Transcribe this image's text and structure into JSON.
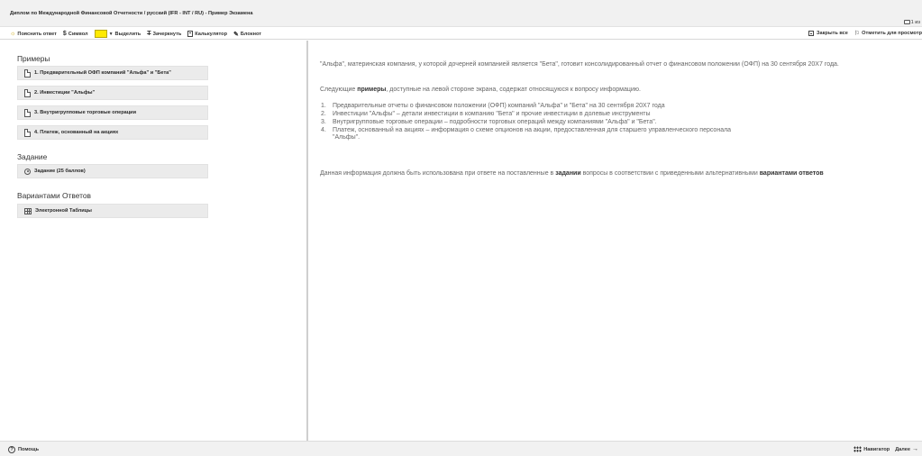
{
  "window": {
    "title": "Диплом по Международной Финансовой Отчетности / русский (IFR - INT / RU) - Пример Экзамена",
    "pager": "1 из"
  },
  "toolbar": {
    "explain_label": "Пояснить ответ",
    "symbol_label": "Символ",
    "highlight_label": "Выделить",
    "strike_label": "Зачеркнуть",
    "calculator_label": "Калькулятор",
    "notepad_label": "Блокнот",
    "close_all_label": "Закрыть все",
    "flag_label": "Отметить для просмотр",
    "highlight_color": "#ffea00"
  },
  "sidebar": {
    "examples_title": "Примеры",
    "examples": [
      "1. Предварительный ОФП компаний \"Альфа\" и \"Бета\"",
      "2. Инвестиции \"Альфы\"",
      "3. Внутригрупповые торговые операции",
      "4. Платеж, основанный на акциях"
    ],
    "task_title": "Задание",
    "task_item": "Задание (25 баллов)",
    "answers_title": "Вариантами Ответов",
    "answers_item": "Электронной Таблицы"
  },
  "content": {
    "intro": "\"Альфа\", материнская компания, у которой дочерней компанией является \"Бета\", готовит консолидированный отчет о финансовом положении (ОФП) на 30 сентября 20X7 года.",
    "p2_start": "Следующие ",
    "p2_bold": "примеры",
    "p2_end": ", доступные на левой стороне экрана, содержат относящуюся к вопросу информацию.",
    "list": [
      {
        "n": "1.",
        "text": "Предварительные отчеты о финансовом положении (ОФП) компаний \"Альфа\" и \"Бета\" на 30 сентября 20X7 года"
      },
      {
        "n": "2.",
        "text": "Инвестиции \"Альфы\" – детали инвестиции в компанию \"Бета\" и прочие инвестиции в долевые инструменты"
      },
      {
        "n": "3.",
        "text": "Внутригрупповые торговые операции – подробности торговых операций между компаниями \"Альфа\" и \"Бета\"."
      },
      {
        "n": "4.",
        "text": "Платеж, основанный на акциях – информация о схеме опционов на акции, предоставленная для старшего управленческого персонала \"Альфы\"."
      }
    ],
    "p3_start": "Данная информация должна быть использована при ответе на поставленные в ",
    "p3_bold1": "задании",
    "p3_mid": " вопросы в соответствии с приведенными альтернативными ",
    "p3_bold2": "вариантами ответов"
  },
  "footer": {
    "help_label": "Помощь",
    "navigator_label": "Навигатор",
    "next_label": "Далее"
  }
}
